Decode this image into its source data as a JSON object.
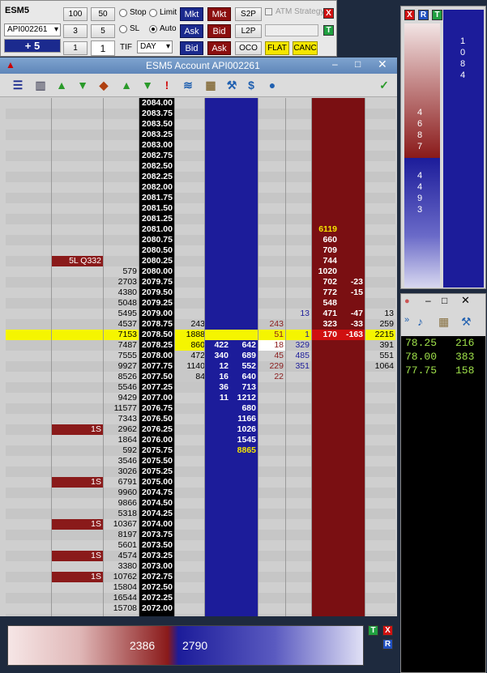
{
  "order_panel": {
    "instrument": "ESM5",
    "account": "API002261",
    "position": "+ 5",
    "qty_buttons": [
      "100",
      "50",
      "3",
      "5",
      "1"
    ],
    "qty_value": "1",
    "stop_label": "Stop",
    "limit_label": "Limit",
    "sl_label": "SL",
    "auto_label": "Auto",
    "tif_label": "TIF",
    "tif_value": "DAY",
    "mkt_buy": "Mkt",
    "mkt_sell": "Mkt",
    "ask_buy": "Ask",
    "bid_sell": "Bid",
    "bid_buy": "Bid",
    "ask_sell": "Ask",
    "s2p": "S2P",
    "l2p": "L2P",
    "oco": "OCO",
    "flat": "FLAT",
    "canc": "CANC",
    "atm_label": "ATM Strategy",
    "close_x": "X",
    "t_btn": "T"
  },
  "dom": {
    "title": "ESM5  Account API002261",
    "rows": [
      {
        "price": "2084.00"
      },
      {
        "price": "2083.75"
      },
      {
        "price": "2083.50"
      },
      {
        "price": "2083.25"
      },
      {
        "price": "2083.00"
      },
      {
        "price": "2082.75"
      },
      {
        "price": "2082.50"
      },
      {
        "price": "2082.25"
      },
      {
        "price": "2082.00"
      },
      {
        "price": "2081.75"
      },
      {
        "price": "2081.50"
      },
      {
        "price": "2081.25"
      },
      {
        "price": "2081.00",
        "ask1": "6119",
        "ask1_yellow": true
      },
      {
        "price": "2080.75",
        "ask1": "660"
      },
      {
        "price": "2080.50",
        "ask1": "709"
      },
      {
        "price": "2080.25",
        "pnl": "5L Q332",
        "ask1": "744"
      },
      {
        "price": "2080.00",
        "vol": "579",
        "ask1": "1020"
      },
      {
        "price": "2079.75",
        "vol": "2703",
        "ask1": "702",
        "ask2": "-23"
      },
      {
        "price": "2079.50",
        "vol": "4380",
        "ask1": "772",
        "ask2": "-15"
      },
      {
        "price": "2079.25",
        "vol": "5048",
        "ask1": "548"
      },
      {
        "price": "2079.00",
        "vol": "5495",
        "bidd": "13",
        "ask1": "471",
        "ask2": "-47",
        "last": "13"
      },
      {
        "price": "2078.75",
        "vol": "4537",
        "sim": "243",
        "ldiff": "243",
        "ask1": "323",
        "ask2": "-33",
        "last": "259"
      },
      {
        "price": "2078.50",
        "vol": "7153",
        "sim": "1888",
        "ldiff": "51",
        "bidd": "1",
        "ask1": "170",
        "ask2": "-163",
        "last": "2215",
        "hilite": true
      },
      {
        "price": "2078.25",
        "vol": "7487",
        "sim": "860",
        "bid1": "422",
        "bid2": "642",
        "ldiff": "18",
        "bidd": "329",
        "last": "391"
      },
      {
        "price": "2078.00",
        "vol": "7555",
        "sim": "472",
        "bid1": "340",
        "bid2": "689",
        "ldiff": "45",
        "bidd": "485",
        "last": "551"
      },
      {
        "price": "2077.75",
        "vol": "9927",
        "sim": "1140",
        "bid1": "12",
        "bid2": "552",
        "ldiff": "229",
        "bidd": "351",
        "last": "1064"
      },
      {
        "price": "2077.50",
        "vol": "8526",
        "sim": "84",
        "bid1": "16",
        "bid2": "640",
        "ldiff": "22"
      },
      {
        "price": "2077.25",
        "vol": "5546",
        "bid1": "36",
        "bid2": "713"
      },
      {
        "price": "2077.00",
        "vol": "9429",
        "bid1": "11",
        "bid2": "1212"
      },
      {
        "price": "2076.75",
        "vol": "11577",
        "bid2": "680"
      },
      {
        "price": "2076.50",
        "vol": "7343",
        "bid2": "1166"
      },
      {
        "price": "2076.25",
        "pnl": "1S",
        "vol": "2962",
        "bid2": "1026"
      },
      {
        "price": "2076.00",
        "vol": "1864",
        "bid2": "1545"
      },
      {
        "price": "2075.75",
        "vol": "592",
        "bid2": "8865",
        "bid2_yellow": true
      },
      {
        "price": "2075.50",
        "vol": "3546"
      },
      {
        "price": "2075.25",
        "vol": "3026"
      },
      {
        "price": "2075.00",
        "pnl": "1S",
        "vol": "6791"
      },
      {
        "price": "2074.75",
        "vol": "9960"
      },
      {
        "price": "2074.50",
        "vol": "9866"
      },
      {
        "price": "2074.25",
        "vol": "5318"
      },
      {
        "price": "2074.00",
        "pnl": "1S",
        "vol": "10367"
      },
      {
        "price": "2073.75",
        "vol": "8197"
      },
      {
        "price": "2073.50",
        "vol": "5601"
      },
      {
        "price": "2073.25",
        "pnl": "1S",
        "vol": "4574"
      },
      {
        "price": "2073.00",
        "vol": "3380"
      },
      {
        "price": "2072.75",
        "pnl": "1S",
        "vol": "10762"
      },
      {
        "price": "2072.50",
        "vol": "15804"
      },
      {
        "price": "2072.25",
        "vol": "16544"
      },
      {
        "price": "2072.00",
        "vol": "15708"
      }
    ]
  },
  "bottom_bar": {
    "sell_total": "2386",
    "buy_total": "2790",
    "t_btn": "T",
    "x_btn": "X",
    "r_btn": "R"
  },
  "right_top": {
    "x_btn": "X",
    "r_btn": "R",
    "t_btn": "T",
    "ask_total": "4687",
    "bid_total": "4493",
    "big_total": "1084"
  },
  "time_sales": {
    "rows": [
      {
        "price": "78.25",
        "size": "216"
      },
      {
        "price": "78.00",
        "size": "383"
      },
      {
        "price": "77.75",
        "size": "158"
      }
    ]
  },
  "colors": {
    "bid_blue": "#1c1c9a",
    "ask_red": "#7a0f12",
    "highlight": "#f5f500",
    "tape_green": "#9fe14a"
  }
}
